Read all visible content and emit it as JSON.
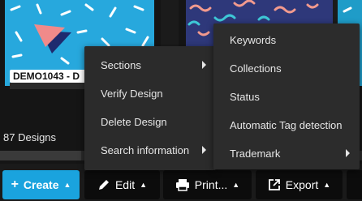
{
  "gallery": {
    "designs": [
      {
        "label": "DEMO1043 - D"
      },
      {
        "label": ""
      },
      {
        "label": ""
      }
    ],
    "design_count": "87 Designs"
  },
  "toolbar": {
    "create_label": "Create",
    "edit_label": "Edit",
    "print_label": "Print...",
    "export_label": "Export"
  },
  "edit_menu": {
    "items": [
      {
        "label": "Sections",
        "has_submenu": true
      },
      {
        "label": "Verify Design",
        "has_submenu": false
      },
      {
        "label": "Delete Design",
        "has_submenu": false
      },
      {
        "label": "Search information",
        "has_submenu": true
      }
    ]
  },
  "sections_submenu": {
    "items": [
      {
        "label": "Keywords",
        "has_submenu": false
      },
      {
        "label": "Collections",
        "has_submenu": false
      },
      {
        "label": "Status",
        "has_submenu": false
      },
      {
        "label": "Automatic Tag detection",
        "has_submenu": false
      },
      {
        "label": "Trademark",
        "has_submenu": true
      }
    ]
  },
  "colors": {
    "accent": "#1aa3de",
    "menu_bg": "#2b2b2b",
    "toolbar_bg": "#0c0c0c"
  }
}
